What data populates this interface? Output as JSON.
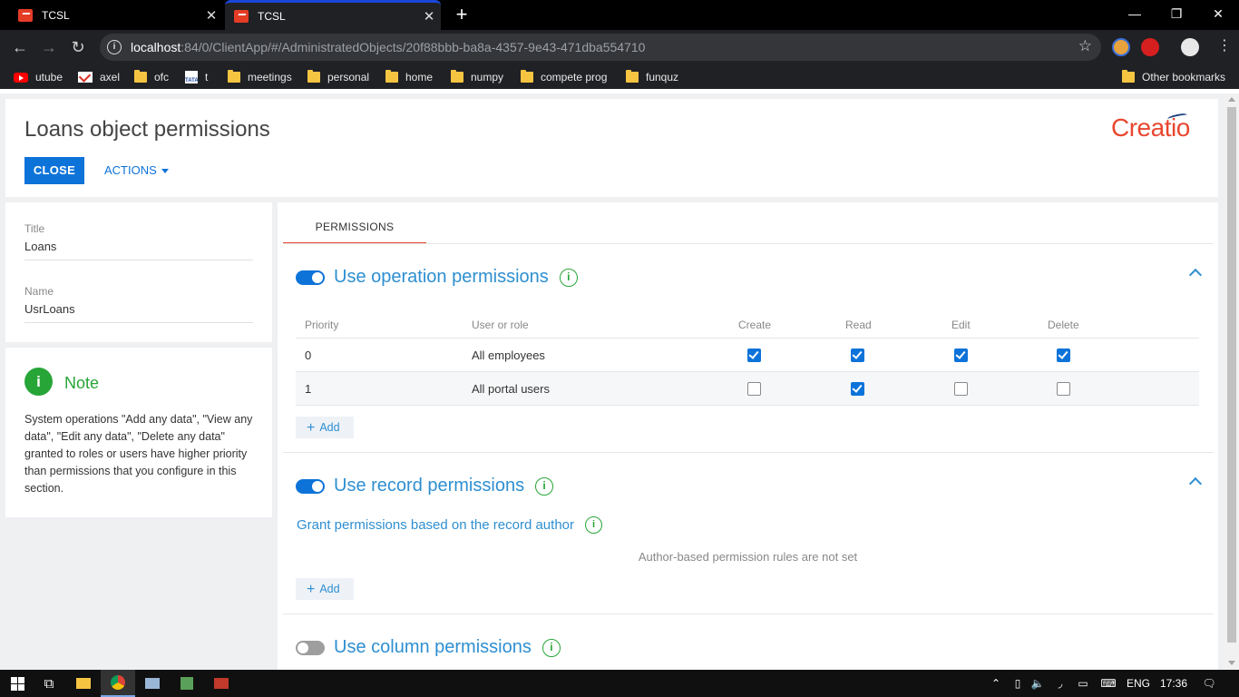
{
  "browser": {
    "tabs": [
      {
        "title": "TCSL",
        "active": false
      },
      {
        "title": "TCSL",
        "active": true
      }
    ],
    "url_host": "localhost",
    "url_rest": ":84/0/ClientApp/#/AdministratedObjects/20f88bbb-ba8a-4357-9e43-471dba554710",
    "bookmarks": [
      {
        "label": "utube",
        "icon": "youtube-icon"
      },
      {
        "label": "axel",
        "icon": "gmail-icon"
      },
      {
        "label": "ofc",
        "icon": "folder-icon"
      },
      {
        "label": "t",
        "icon": "tata-icon"
      },
      {
        "label": "meetings",
        "icon": "folder-icon"
      },
      {
        "label": "personal",
        "icon": "folder-icon"
      },
      {
        "label": "home",
        "icon": "folder-icon"
      },
      {
        "label": "numpy",
        "icon": "folder-icon"
      },
      {
        "label": "compete prog",
        "icon": "folder-icon"
      },
      {
        "label": "funquz",
        "icon": "folder-icon"
      }
    ],
    "other_bookmarks": "Other bookmarks",
    "tata_text": "TATA"
  },
  "header": {
    "title": "Loans object permissions",
    "close_label": "CLOSE",
    "actions_label": "ACTIONS",
    "logo_text": "Creatio"
  },
  "fields": {
    "title_label": "Title",
    "title_value": "Loans",
    "name_label": "Name",
    "name_value": "UsrLoans"
  },
  "note": {
    "icon_text": "i",
    "title": "Note",
    "text": "System operations \"Add any data\", \"View any data\", \"Edit any data\", \"Delete any data\" granted to roles or users have higher priority than permissions that you configure in this section."
  },
  "tabs": {
    "permissions": "PERMISSIONS"
  },
  "operation": {
    "title": "Use operation permissions",
    "enabled": true,
    "columns": {
      "priority": "Priority",
      "user_or_role": "User or role",
      "create": "Create",
      "read": "Read",
      "edit": "Edit",
      "delete": "Delete"
    },
    "rows": [
      {
        "priority": "0",
        "user_or_role": "All employees",
        "create": true,
        "read": true,
        "edit": true,
        "delete": true
      },
      {
        "priority": "1",
        "user_or_role": "All portal users",
        "create": false,
        "read": true,
        "edit": false,
        "delete": false
      }
    ],
    "add_label": "Add"
  },
  "record": {
    "title": "Use record permissions",
    "enabled": true,
    "grant_link": "Grant permissions based on the record author",
    "empty_message": "Author-based permission rules are not set",
    "add_label": "Add"
  },
  "column": {
    "title": "Use column permissions",
    "enabled": false
  },
  "info_glyph": "i",
  "taskbar": {
    "language": "ENG",
    "time": "17:36"
  },
  "colors": {
    "primary": "#0d73d9",
    "section_title": "#2e8fd1",
    "note_green": "#27a537",
    "brand": "#e8472f"
  }
}
